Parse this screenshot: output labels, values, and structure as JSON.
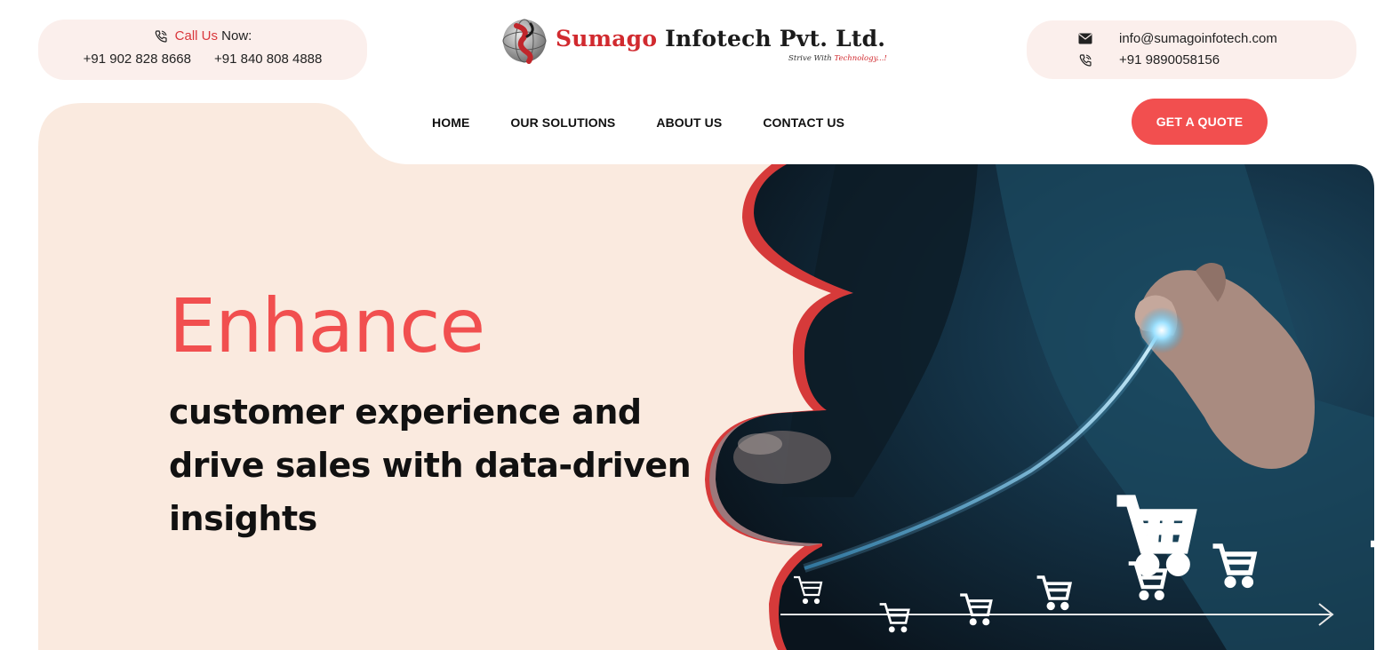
{
  "topbar": {
    "left": {
      "call_label_red": "Call Us",
      "call_label_rest": "Now:",
      "phone1": "+91 902 828 8668",
      "phone2": "+91 840 808 4888"
    },
    "right": {
      "email": "info@sumagoinfotech.com",
      "phone": "+91 9890058156"
    }
  },
  "logo": {
    "name_red": "Sumago",
    "name_dark": "Infotech Pvt. Ltd.",
    "tagline_dark": "Strive With",
    "tagline_red": "Technology...!"
  },
  "nav": {
    "items": [
      "HOME",
      "OUR SOLUTIONS",
      "ABOUT US",
      "CONTACT US"
    ],
    "cta": "GET A QUOTE"
  },
  "hero": {
    "title": "Enhance",
    "subtitle": "customer experience and drive sales with data-driven insights"
  },
  "colors": {
    "accent": "#f24f4f",
    "brand_red": "#d12a2f",
    "cream": "#faeadf",
    "pill_bg": "#fbefec"
  },
  "icons": {
    "phone": "phone-icon",
    "email": "envelope-icon",
    "cart": "shopping-cart-icon"
  }
}
